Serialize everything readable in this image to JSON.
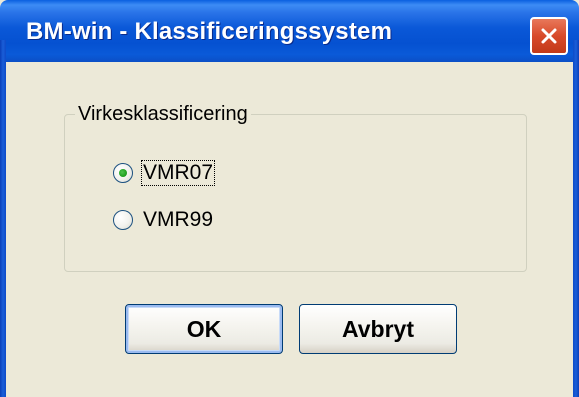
{
  "window": {
    "title": "BM-win - Klassificeringssystem"
  },
  "titlebar": {
    "close_icon": "close-icon"
  },
  "groupbox": {
    "label": "Virkesklassificering",
    "options": [
      {
        "label": "VMR07",
        "selected": true
      },
      {
        "label": "VMR99",
        "selected": false
      }
    ]
  },
  "buttons": {
    "ok_label": "OK",
    "cancel_label": "Avbryt"
  },
  "colors": {
    "titlebar": "#0551d1",
    "dialog_background": "#ece9d8",
    "close_button": "#d84a2a",
    "radio_selected": "#21a121"
  }
}
